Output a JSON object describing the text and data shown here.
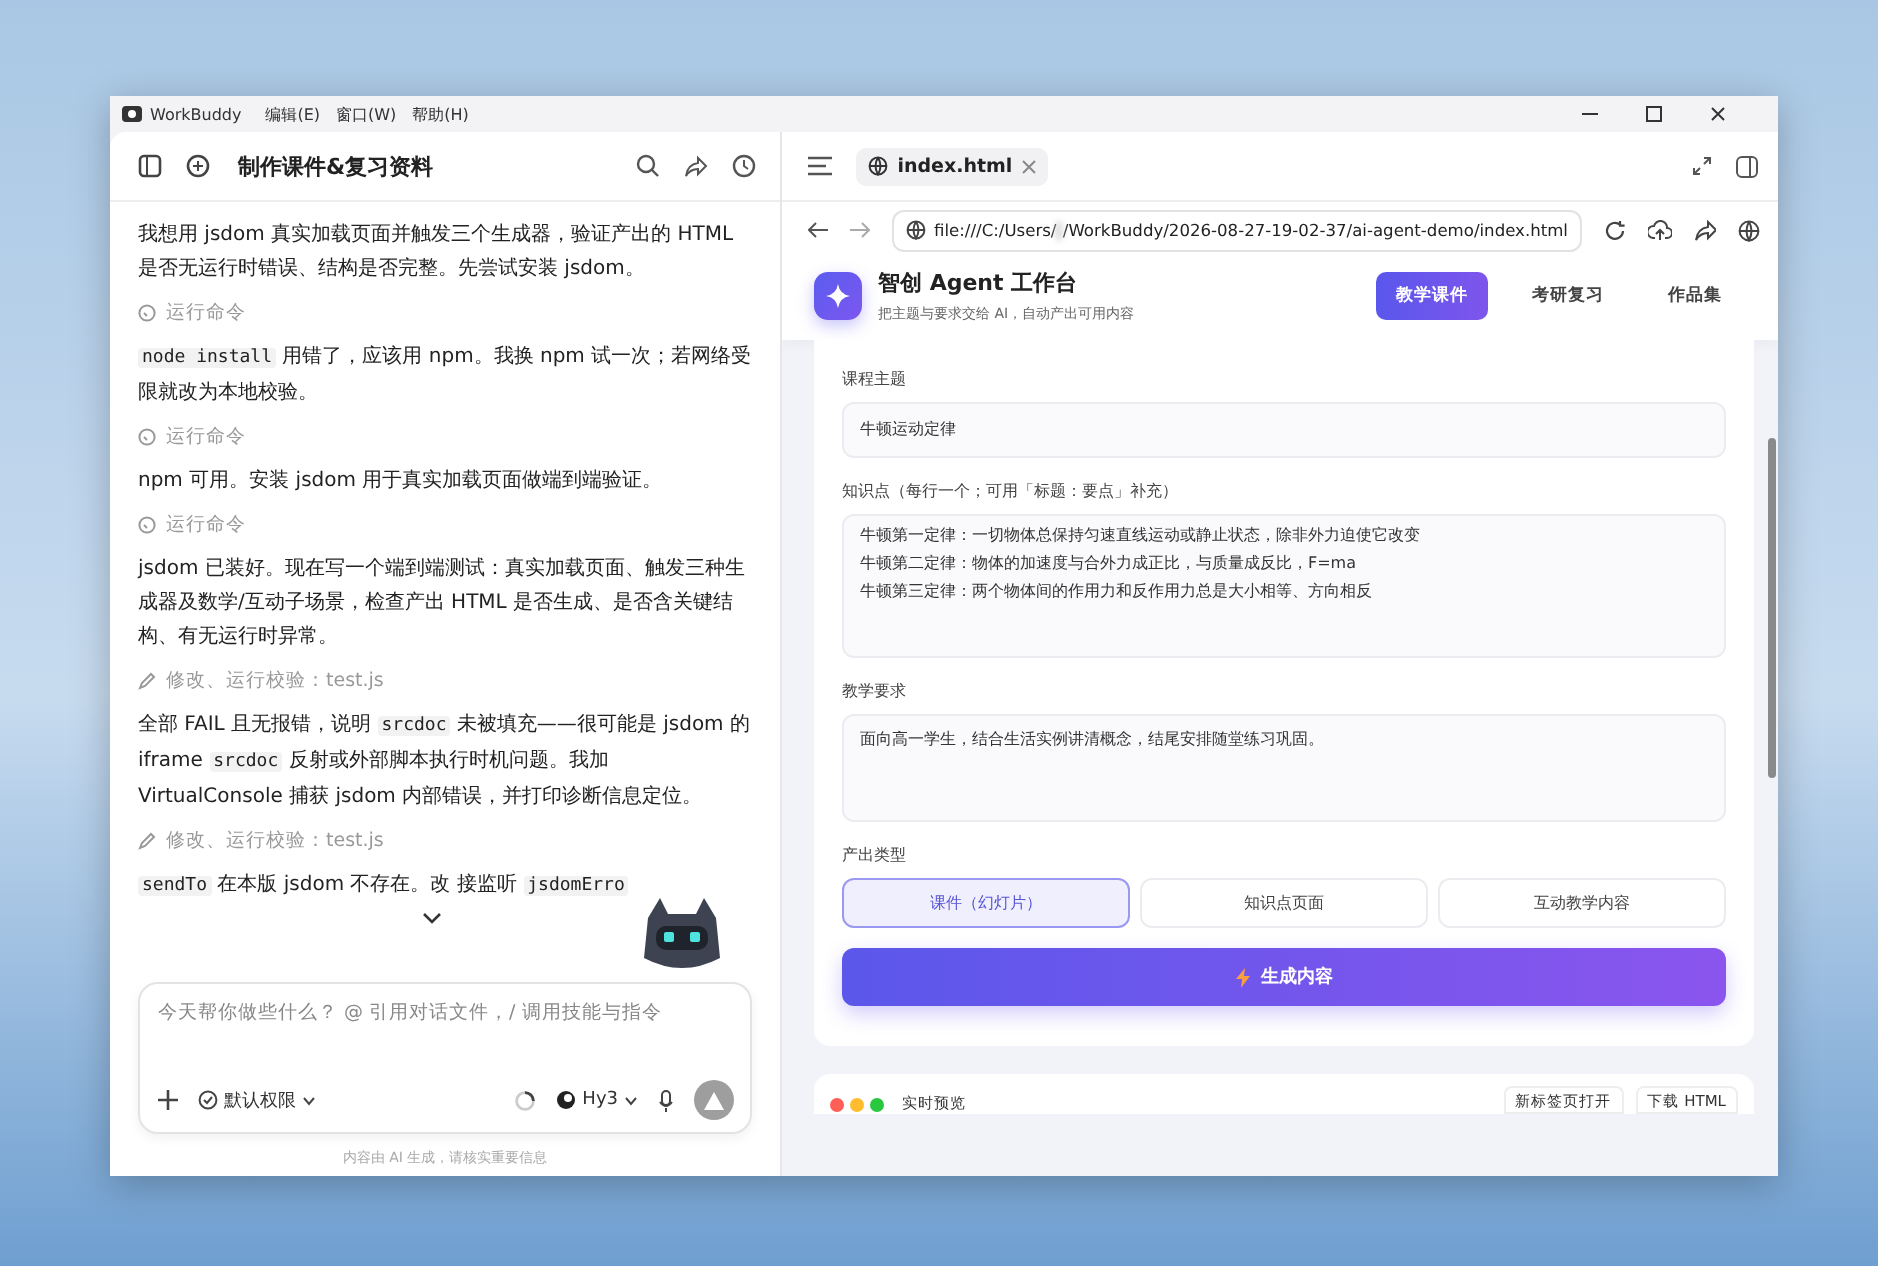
{
  "window": {
    "app_name": "WorkBuddy",
    "menu": [
      "编辑(E)",
      "窗口(W)",
      "帮助(H)"
    ]
  },
  "chat": {
    "title": "制作课件&复习资料",
    "items": [
      {
        "kind": "message",
        "segments": [
          {
            "kind": "text",
            "text": "我想用 jsdom 真实加载页面并触发三个生成器，验证产出的 HTML 是否无运行时错误、结构是否完整。先尝试安装 jsdom。"
          }
        ]
      },
      {
        "kind": "command",
        "text": "运行命令"
      },
      {
        "kind": "message",
        "segments": [
          {
            "kind": "code",
            "text": "node install"
          },
          {
            "kind": "text",
            "text": " 用错了，应该用 npm。我换 npm 试一次；若网络受限就改为本地校验。"
          }
        ]
      },
      {
        "kind": "command",
        "text": "运行命令"
      },
      {
        "kind": "message",
        "segments": [
          {
            "kind": "text",
            "text": "npm 可用。安装 jsdom 用于真实加载页面做端到端验证。"
          }
        ]
      },
      {
        "kind": "command",
        "text": "运行命令"
      },
      {
        "kind": "message",
        "segments": [
          {
            "kind": "text",
            "text": "jsdom 已装好。现在写一个端到端测试：真实加载页面、触发三种生成器及数学/互动子场景，检查产出 HTML 是否生成、是否含关键结构、有无运行时异常。"
          }
        ]
      },
      {
        "kind": "edit",
        "text": "修改、运行校验：test.js"
      },
      {
        "kind": "message",
        "segments": [
          {
            "kind": "text",
            "text": "全部 FAIL 且无报错，说明 "
          },
          {
            "kind": "code",
            "text": "srcdoc"
          },
          {
            "kind": "text",
            "text": " 未被填充——很可能是 jsdom 的 iframe "
          },
          {
            "kind": "code",
            "text": "srcdoc"
          },
          {
            "kind": "text",
            "text": " 反射或外部脚本执行时机问题。我加 VirtualConsole 捕获 jsdom 内部错误，并打印诊断信息定位。"
          }
        ]
      },
      {
        "kind": "edit",
        "text": "修改、运行校验：test.js"
      },
      {
        "kind": "message",
        "segments": [
          {
            "kind": "code",
            "text": "sendTo"
          },
          {
            "kind": "text",
            "text": " 在本版 jsdom 不存在。改"
          },
          {
            "kind": "text",
            "text": " 接监听 "
          },
          {
            "kind": "code",
            "text": "jsdomErro"
          }
        ]
      }
    ],
    "input": {
      "placeholder": "今天帮你做些什么？ @ 引用对话文件，/ 调用技能与指令",
      "permission": "默认权限",
      "model": "Hy3"
    },
    "disclaimer": "内容由 AI 生成，请核实重要信息"
  },
  "browser": {
    "tab": "index.html",
    "url": "file:///C:/Users/",
    "url_rest": "/WorkBuddy/2026-08-27-19-02-37/ai-agent-demo/index.html"
  },
  "page": {
    "brand": "智创 Agent 工作台",
    "tagline": "把主题与要求交给 AI，自动产出可用内容",
    "nav": [
      {
        "label": "教学课件",
        "selected": true
      },
      {
        "label": "考研复习",
        "selected": false
      },
      {
        "label": "作品集",
        "selected": false
      }
    ],
    "topic": {
      "label": "课程主题",
      "value": "牛顿运动定律"
    },
    "points": {
      "label": "知识点（每行一个；可用「标题：要点」补充）",
      "lines": [
        "牛顿第一定律：一切物体总保持匀速直线运动或静止状态，除非外力迫使它改变",
        "牛顿第二定律：物体的加速度与合外力成正比，与质量成反比，F=ma",
        "牛顿第三定律：两个物体间的作用力和反作用力总是大小相等、方向相反"
      ]
    },
    "requirement": {
      "label": "教学要求",
      "value": "面向高一学生，结合生活实例讲清概念，结尾安排随堂练习巩固。"
    },
    "output_type": {
      "label": "产出类型",
      "options": [
        {
          "label": "课件（幻灯片）",
          "selected": true
        },
        {
          "label": "知识点页面",
          "selected": false
        },
        {
          "label": "互动教学内容",
          "selected": false
        }
      ]
    },
    "generate": "生成内容",
    "preview": {
      "title": "实时预览",
      "actions": [
        "新标签页打开",
        "下载 HTML"
      ]
    }
  }
}
